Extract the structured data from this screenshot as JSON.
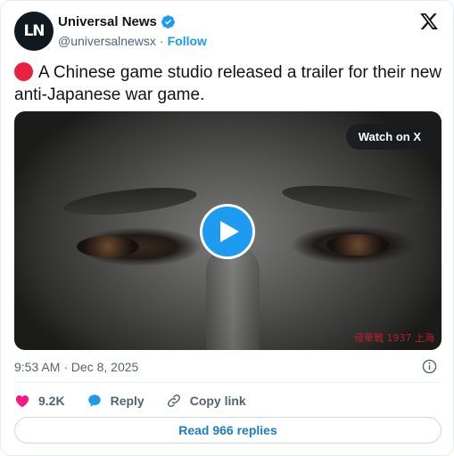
{
  "account": {
    "avatar_text": "LN",
    "display_name": "Universal News",
    "handle": "@universalnewsx",
    "separator": "·",
    "follow_label": "Follow"
  },
  "post": {
    "text": "A Chinese game studio released a trailer for their new anti-Japanese war game.",
    "bullet_icon": "red-circle",
    "media": {
      "watch_label": "Watch on X",
      "watermark_text": "侵華戰 1937 上海"
    },
    "timestamp": "9:53 AM · Dec 8, 2025"
  },
  "actions": {
    "like_count": "9.2K",
    "reply_label": "Reply",
    "copy_link_label": "Copy link"
  },
  "read_replies_label": "Read 966 replies",
  "colors": {
    "accent": "#1d9bf0",
    "like": "#f91880",
    "bullet": "#e8223f"
  }
}
